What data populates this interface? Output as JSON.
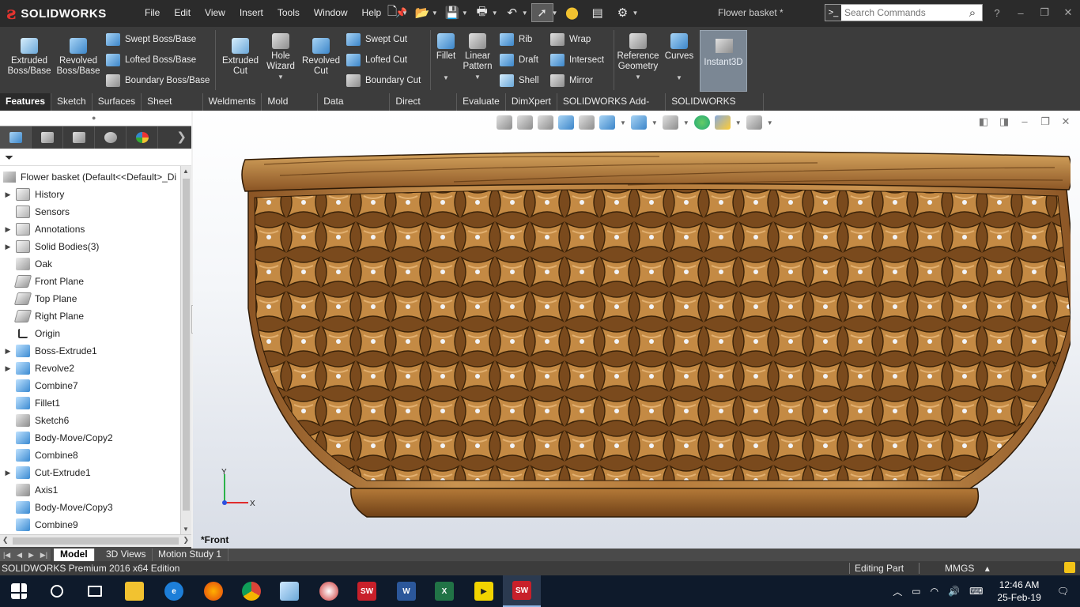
{
  "app": {
    "logo_text": "SOLIDWORKS",
    "document_title": "Flower basket *",
    "menus": [
      "File",
      "Edit",
      "View",
      "Insert",
      "Tools",
      "Window",
      "Help"
    ],
    "search_placeholder": "Search Commands",
    "window_controls": [
      "?",
      "–",
      "❐",
      "✕"
    ]
  },
  "command_manager": {
    "extruded_boss": "Extruded\nBoss/Base",
    "revolved_boss": "Revolved\nBoss/Base",
    "swept_boss": "Swept Boss/Base",
    "lofted_boss": "Lofted Boss/Base",
    "boundary_boss": "Boundary Boss/Base",
    "extruded_cut": "Extruded\nCut",
    "hole_wizard": "Hole\nWizard",
    "revolved_cut": "Revolved\nCut",
    "swept_cut": "Swept Cut",
    "lofted_cut": "Lofted Cut",
    "boundary_cut": "Boundary Cut",
    "fillet": "Fillet",
    "linear_pattern": "Linear\nPattern",
    "rib": "Rib",
    "draft": "Draft",
    "shell": "Shell",
    "wrap": "Wrap",
    "intersect": "Intersect",
    "mirror": "Mirror",
    "reference_geometry": "Reference\nGeometry",
    "curves": "Curves",
    "instant3d": "Instant3D"
  },
  "tabs": [
    "Features",
    "Sketch",
    "Surfaces",
    "Sheet Metal",
    "Weldments",
    "Mold Tools",
    "Data Migration",
    "Direct Editing",
    "Evaluate",
    "DimXpert",
    "SOLIDWORKS Add-Ins",
    "SOLIDWORKS MBD"
  ],
  "feature_tree": {
    "root": "Flower basket  (Default<<Default>_Di",
    "items": [
      {
        "label": "History",
        "expandable": true,
        "icon": "history-icon"
      },
      {
        "label": "Sensors",
        "expandable": false,
        "icon": "sensors-icon"
      },
      {
        "label": "Annotations",
        "expandable": true,
        "icon": "annotations-icon"
      },
      {
        "label": "Solid Bodies(3)",
        "expandable": true,
        "icon": "solid-bodies-icon"
      },
      {
        "label": "Oak",
        "expandable": false,
        "icon": "material-icon"
      },
      {
        "label": "Front Plane",
        "expandable": false,
        "icon": "plane-icon"
      },
      {
        "label": "Top Plane",
        "expandable": false,
        "icon": "plane-icon"
      },
      {
        "label": "Right Plane",
        "expandable": false,
        "icon": "plane-icon"
      },
      {
        "label": "Origin",
        "expandable": false,
        "icon": "origin-icon"
      },
      {
        "label": "Boss-Extrude1",
        "expandable": true,
        "icon": "extrude-icon"
      },
      {
        "label": "Revolve2",
        "expandable": true,
        "icon": "revolve-icon"
      },
      {
        "label": "Combine7",
        "expandable": false,
        "icon": "combine-icon"
      },
      {
        "label": "Fillet1",
        "expandable": false,
        "icon": "fillet-icon"
      },
      {
        "label": "Sketch6",
        "expandable": false,
        "icon": "sketch-icon"
      },
      {
        "label": "Body-Move/Copy2",
        "expandable": false,
        "icon": "move-copy-icon"
      },
      {
        "label": "Combine8",
        "expandable": false,
        "icon": "combine-icon"
      },
      {
        "label": "Cut-Extrude1",
        "expandable": true,
        "icon": "cut-extrude-icon"
      },
      {
        "label": "Axis1",
        "expandable": false,
        "icon": "axis-icon"
      },
      {
        "label": "Body-Move/Copy3",
        "expandable": false,
        "icon": "move-copy-icon"
      },
      {
        "label": "Combine9",
        "expandable": false,
        "icon": "combine-icon"
      }
    ]
  },
  "viewport": {
    "view_label": "*Front",
    "triad": {
      "x": "X",
      "y": "Y"
    }
  },
  "bottom_tabs": [
    "Model",
    "3D Views",
    "Motion Study 1"
  ],
  "status": {
    "left": "SOLIDWORKS Premium 2016 x64 Edition",
    "mode": "Editing Part",
    "units": "MMGS",
    "units_caret": "▴"
  },
  "taskbar": {
    "time": "12:46 AM",
    "date": "25-Feb-19",
    "apps": [
      "start",
      "search",
      "task-view",
      "file-explorer",
      "edge",
      "firefox",
      "chrome",
      "notepad",
      "paint",
      "solidworks-2016",
      "word",
      "excel",
      "player",
      "solidworks-2016-active"
    ]
  },
  "colors": {
    "accent_red": "#e3342f",
    "wood_light": "#c9924a",
    "wood_dark": "#6b3f17"
  }
}
